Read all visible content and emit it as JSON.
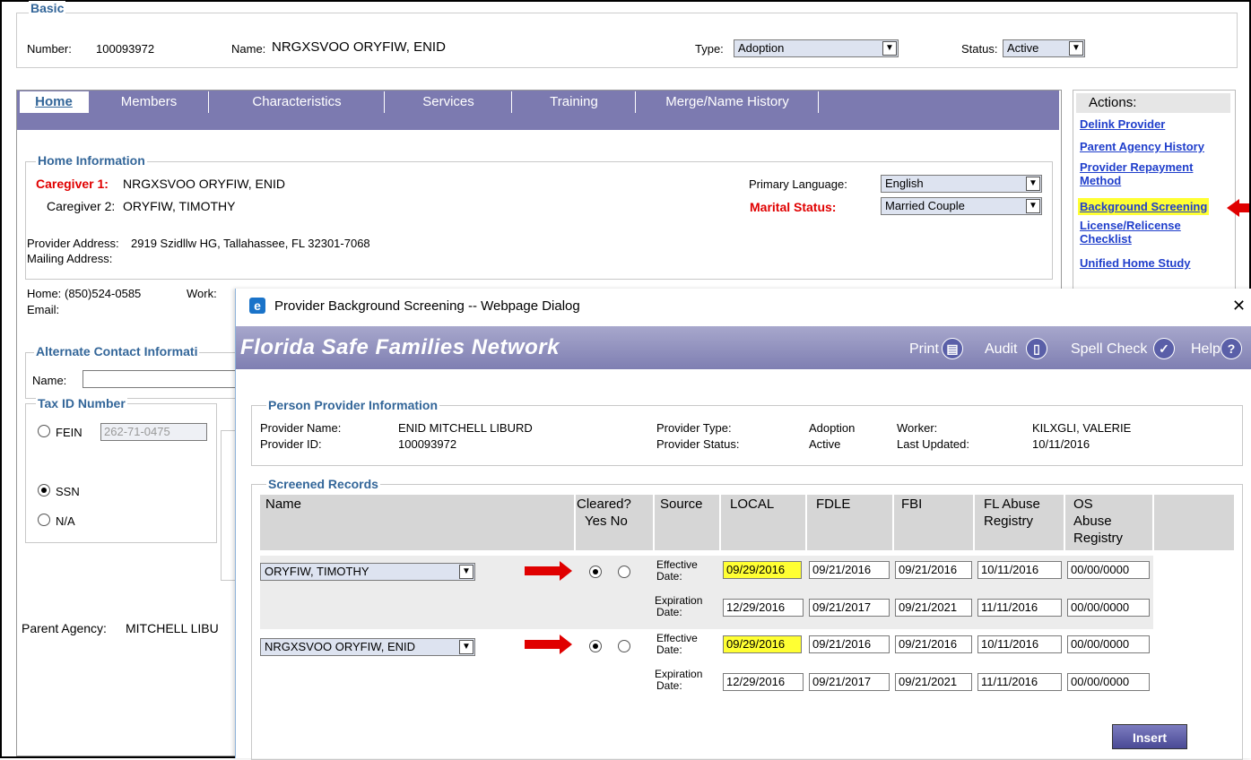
{
  "basic": {
    "legend": "Basic",
    "number_label": "Number:",
    "number_value": "100093972",
    "name_label": "Name:",
    "name_value": "NRGXSVOO ORYFIW, ENID",
    "type_label": "Type:",
    "type_value": "Adoption",
    "status_label": "Status:",
    "status_value": "Active"
  },
  "tabs": [
    "Home",
    "Members",
    "Characteristics",
    "Services",
    "Training",
    "Merge/Name History"
  ],
  "actions": {
    "title": "Actions:",
    "items": [
      "Delink Provider",
      "Parent Agency History",
      "Provider Repayment Method",
      "Background Screening",
      "License/Relicense Checklist",
      "Unified Home Study"
    ]
  },
  "home_info": {
    "legend": "Home Information",
    "cg1_label": "Caregiver 1:",
    "cg1_value": "NRGXSVOO ORYFIW, ENID",
    "cg2_label": "Caregiver 2:",
    "cg2_value": "ORYFIW, TIMOTHY",
    "lang_label": "Primary Language:",
    "lang_value": "English",
    "marital_label": "Marital Status:",
    "marital_value": "Married Couple",
    "address_label": "Provider Address:",
    "address_value": "2919 Szidllw HG, Tallahassee, FL 32301-7068",
    "mailing_label": "Mailing Address:",
    "home_label": "Home:",
    "home_value": "(850)524-0585",
    "work_label": "Work:",
    "email_label": "Email:"
  },
  "alt_contact": {
    "legend": "Alternate Contact Informati",
    "name_label": "Name:"
  },
  "tax": {
    "legend": "Tax ID Number",
    "fein_label": "FEIN",
    "fein_value": "262-71-0475",
    "ssn_label": "SSN",
    "na_label": "N/A"
  },
  "parent_agency": {
    "label": "Parent Agency:",
    "value": "MITCHELL LIBU"
  },
  "dialog": {
    "title": "Provider Background Screening -- Webpage Dialog",
    "close": "✕",
    "app_title": "Florida Safe Families Network",
    "toolbar": [
      "Print",
      "Audit",
      "Spell Check",
      "Help"
    ],
    "person": {
      "legend": "Person Provider Information",
      "name_label": "Provider Name:",
      "name_value": "ENID MITCHELL LIBURD",
      "id_label": "Provider ID:",
      "id_value": "100093972",
      "type_label": "Provider Type:",
      "type_value": "Adoption",
      "status_label": "Provider Status:",
      "status_value": "Active",
      "worker_label": "Worker:",
      "worker_value": "KILXGLI, VALERIE",
      "updated_label": "Last Updated:",
      "updated_value": "10/11/2016"
    },
    "screened": {
      "legend": "Screened Records",
      "headers": {
        "name": "Name",
        "cleared": "Cleared?",
        "yesno": "Yes No",
        "source": "Source",
        "local": "LOCAL",
        "fdle": "FDLE",
        "fbi": "FBI",
        "flabuse1": "FL Abuse",
        "flabuse2": "Registry",
        "os1": "OS",
        "os2": "Abuse",
        "os3": "Registry"
      },
      "eff_label1": "Effective",
      "eff_label2": "Date:",
      "exp_label1": "Expiration",
      "exp_label2": "Date:",
      "rows": [
        {
          "name": "ORYFIW, TIMOTHY",
          "eff": [
            "09/29/2016",
            "09/21/2016",
            "09/21/2016",
            "10/11/2016",
            "00/00/0000"
          ],
          "exp": [
            "12/29/2016",
            "09/21/2017",
            "09/21/2021",
            "11/11/2016",
            "00/00/0000"
          ]
        },
        {
          "name": "NRGXSVOO ORYFIW, ENID",
          "eff": [
            "09/29/2016",
            "09/21/2016",
            "09/21/2016",
            "10/11/2016",
            "00/00/0000"
          ],
          "exp": [
            "12/29/2016",
            "09/21/2017",
            "09/21/2021",
            "11/11/2016",
            "00/00/0000"
          ]
        }
      ],
      "insert_label": "Insert"
    }
  },
  "colors": {
    "accent": "#336699",
    "tabbar": "#7c7ab0",
    "highlight": "#ffff33",
    "arrow": "#e00000"
  }
}
